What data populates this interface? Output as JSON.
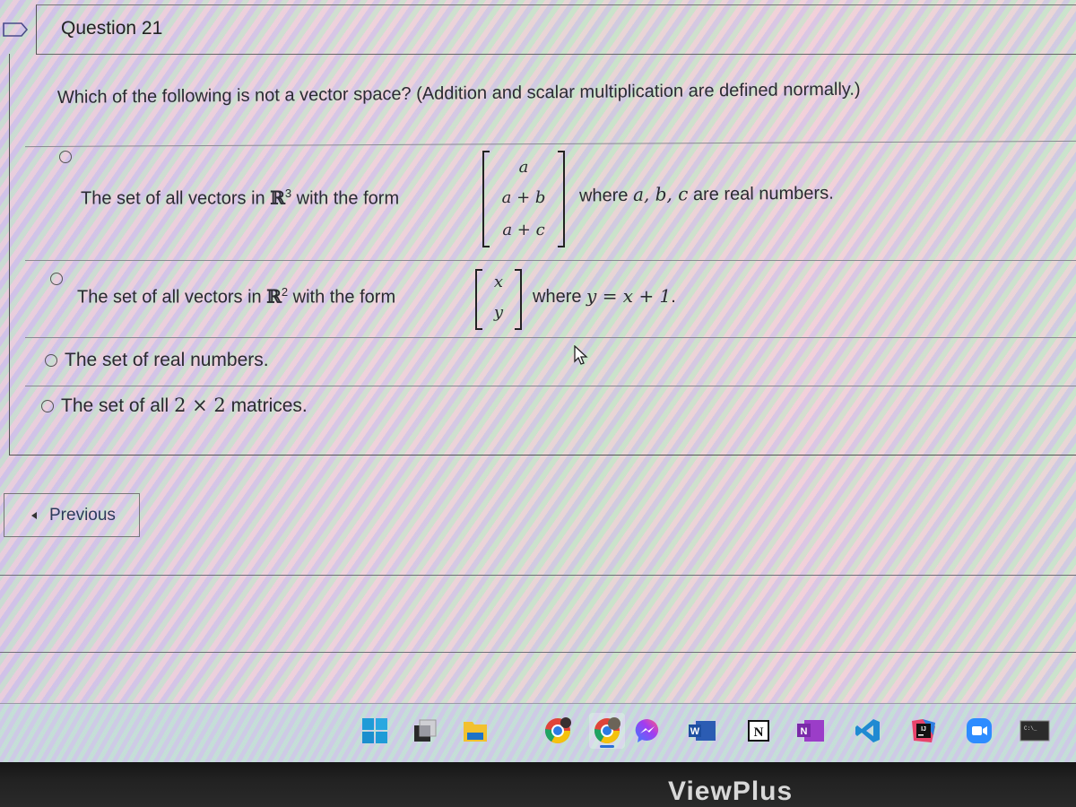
{
  "question": {
    "title": "Question 21",
    "prompt": "Which of the following is not a vector space? (Addition and scalar multiplication are defined normally.)"
  },
  "options": [
    {
      "text_before": "The set of all vectors in ",
      "space": "ℝ",
      "dimension": "3",
      "text_after_space": " with the form",
      "matrix": [
        "a",
        "a + b",
        "a + c"
      ],
      "tail_prefix": "where ",
      "tail_math": "a, b, c",
      "tail_suffix": " are real numbers.",
      "selected": false
    },
    {
      "text_before": "The set of all vectors in ",
      "space": "ℝ",
      "dimension": "2",
      "text_after_space": " with the form",
      "matrix": [
        "x",
        "y"
      ],
      "tail_prefix": "where ",
      "tail_math": "y = x + 1",
      "tail_suffix": ".",
      "selected": false
    },
    {
      "text": "The set of real numbers.",
      "selected": false
    },
    {
      "text_before": "The set of all ",
      "math": "2 × 2",
      "text_after": " matrices.",
      "selected": false
    }
  ],
  "navigation": {
    "previous_label": "Previous"
  },
  "taskbar": {
    "items": [
      {
        "name": "start",
        "icon": "windows-start-icon"
      },
      {
        "name": "task-view",
        "icon": "task-view-icon"
      },
      {
        "name": "file-explorer",
        "icon": "file-explorer-icon"
      },
      {
        "name": "chrome-profile-1",
        "icon": "chrome-icon"
      },
      {
        "name": "chrome-profile-2",
        "icon": "chrome-icon",
        "active": true
      },
      {
        "name": "messenger",
        "icon": "messenger-icon"
      },
      {
        "name": "word",
        "icon": "word-icon",
        "label": "W"
      },
      {
        "name": "notion",
        "icon": "notion-icon",
        "label": "N"
      },
      {
        "name": "onenote",
        "icon": "onenote-icon",
        "label": "N"
      },
      {
        "name": "vscode",
        "icon": "vscode-icon"
      },
      {
        "name": "intellij",
        "icon": "intellij-icon",
        "label": "IJ"
      },
      {
        "name": "zoom",
        "icon": "zoom-icon"
      },
      {
        "name": "terminal",
        "icon": "terminal-icon",
        "label": "C:\\_"
      }
    ]
  },
  "monitor": {
    "brand": "ViewPlus"
  },
  "colors": {
    "text": "#2b2b33",
    "border": "#555555",
    "bezel": "#1e1e1e",
    "taskbar_active": "#2a6fd6"
  }
}
